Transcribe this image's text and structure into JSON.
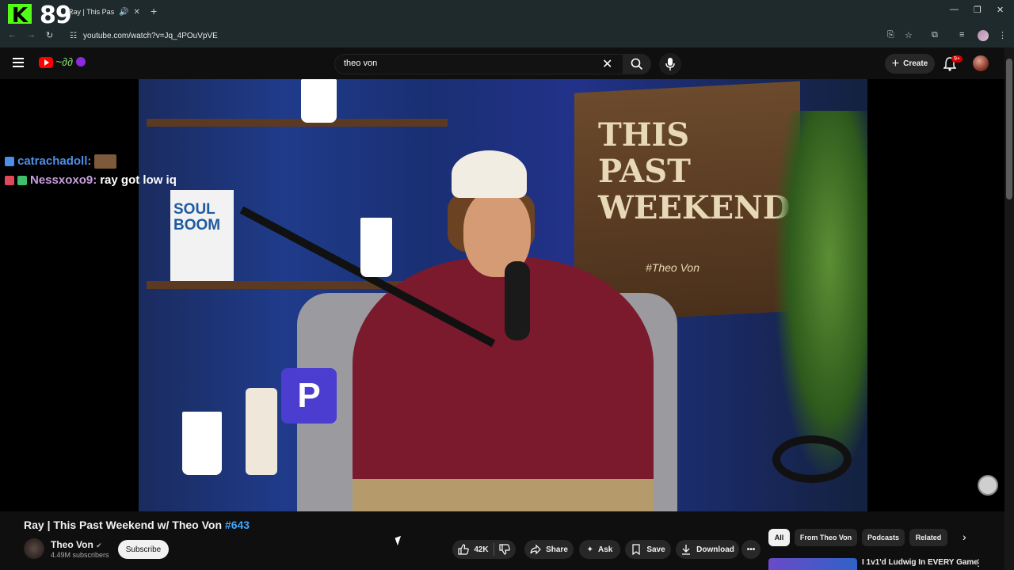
{
  "browser": {
    "viewer_count": "89",
    "tab_title": "Ray | This Past Weeke",
    "url": "youtube.com/watch?v=Jq_4POuVpVE"
  },
  "header": {
    "search_value": "theo von",
    "create_label": "Create",
    "notif_badge": "9+"
  },
  "chat": [
    {
      "user": "catrachadoll:",
      "message": ""
    },
    {
      "user": "Nessxoxo9:",
      "message": "ray got low iq"
    }
  ],
  "video_overlay": {
    "sign_text": "THIS PAST WEEKEND",
    "sign_sub": "#Theo Von",
    "book_title": "SOUL BOOM"
  },
  "video": {
    "title": "Ray | This Past Weekend w/ Theo Von",
    "hashtag": "#643",
    "channel": "Theo Von",
    "subscribers": "4.49M subscribers",
    "subscribe_label": "Subscribe",
    "likes": "42K",
    "share_label": "Share",
    "ask_label": "Ask",
    "save_label": "Save",
    "download_label": "Download"
  },
  "chips": [
    "All",
    "From Theo Von",
    "Podcasts",
    "Related"
  ],
  "recommendation": {
    "title": "I 1v1'd Ludwig In EVERY Game"
  }
}
